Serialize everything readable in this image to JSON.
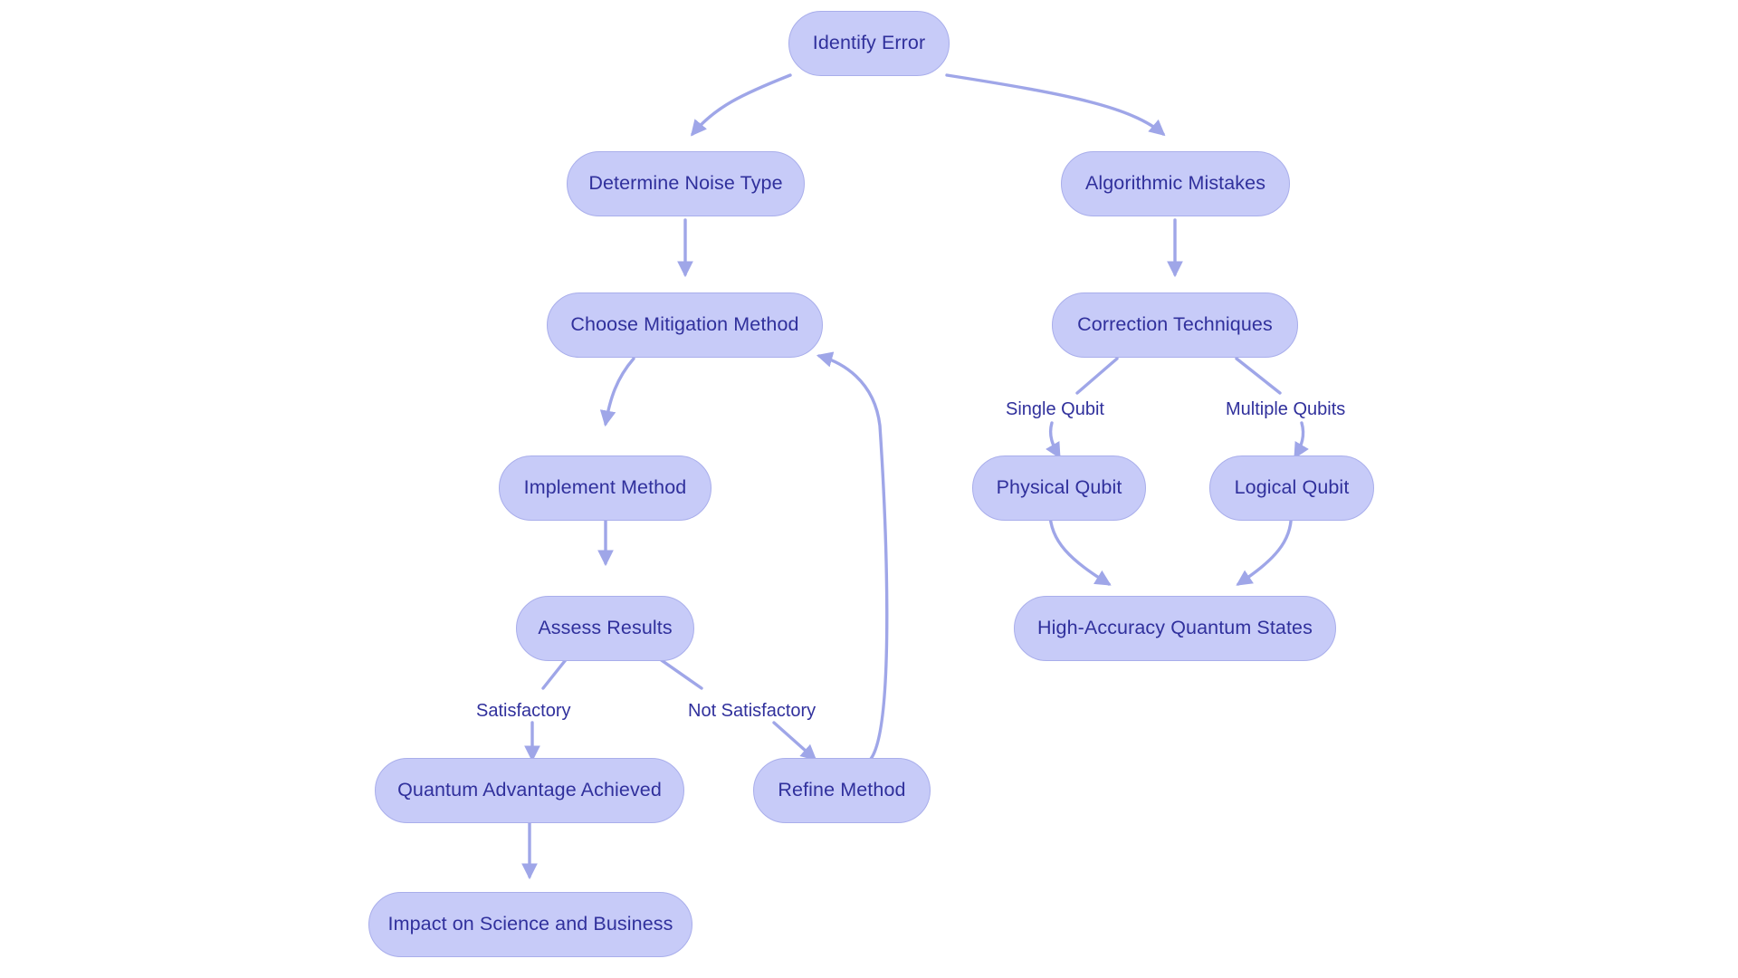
{
  "diagram": {
    "title": "Quantum Error Mitigation and Correction Flowchart",
    "type": "flowchart",
    "direction": "top-down",
    "background_color": "#ffffff",
    "node_fill_color": "#c7cbf8",
    "node_border_color": "#a9aeeb",
    "node_text_color": "#30309c",
    "edge_color": "#9fa6e8",
    "edge_label_text_color": "#30309c"
  },
  "nodes": {
    "identify_error": "Identify Error",
    "determine_noise_type": "Determine Noise Type",
    "algorithmic_mistakes": "Algorithmic Mistakes",
    "choose_mitigation_method": "Choose Mitigation Method",
    "correction_techniques": "Correction Techniques",
    "implement_method": "Implement Method",
    "physical_qubit": "Physical Qubit",
    "logical_qubit": "Logical Qubit",
    "assess_results": "Assess Results",
    "high_accuracy_quantum_states": "High-Accuracy Quantum States",
    "quantum_advantage_achieved": "Quantum Advantage Achieved",
    "refine_method": "Refine Method",
    "impact_on_science_and_business": "Impact on Science and Business"
  },
  "edge_labels": {
    "single_qubit": "Single Qubit",
    "multiple_qubits": "Multiple Qubits",
    "satisfactory": "Satisfactory",
    "not_satisfactory": "Not Satisfactory"
  },
  "edges": [
    {
      "from": "identify_error",
      "to": "determine_noise_type",
      "label": ""
    },
    {
      "from": "identify_error",
      "to": "algorithmic_mistakes",
      "label": ""
    },
    {
      "from": "determine_noise_type",
      "to": "choose_mitigation_method",
      "label": ""
    },
    {
      "from": "algorithmic_mistakes",
      "to": "correction_techniques",
      "label": ""
    },
    {
      "from": "choose_mitigation_method",
      "to": "implement_method",
      "label": ""
    },
    {
      "from": "correction_techniques",
      "to": "physical_qubit",
      "label": "Single Qubit"
    },
    {
      "from": "correction_techniques",
      "to": "logical_qubit",
      "label": "Multiple Qubits"
    },
    {
      "from": "implement_method",
      "to": "assess_results",
      "label": ""
    },
    {
      "from": "physical_qubit",
      "to": "high_accuracy_quantum_states",
      "label": ""
    },
    {
      "from": "logical_qubit",
      "to": "high_accuracy_quantum_states",
      "label": ""
    },
    {
      "from": "assess_results",
      "to": "quantum_advantage_achieved",
      "label": "Satisfactory"
    },
    {
      "from": "assess_results",
      "to": "refine_method",
      "label": "Not Satisfactory"
    },
    {
      "from": "refine_method",
      "to": "choose_mitigation_method",
      "label": ""
    },
    {
      "from": "quantum_advantage_achieved",
      "to": "impact_on_science_and_business",
      "label": ""
    }
  ]
}
